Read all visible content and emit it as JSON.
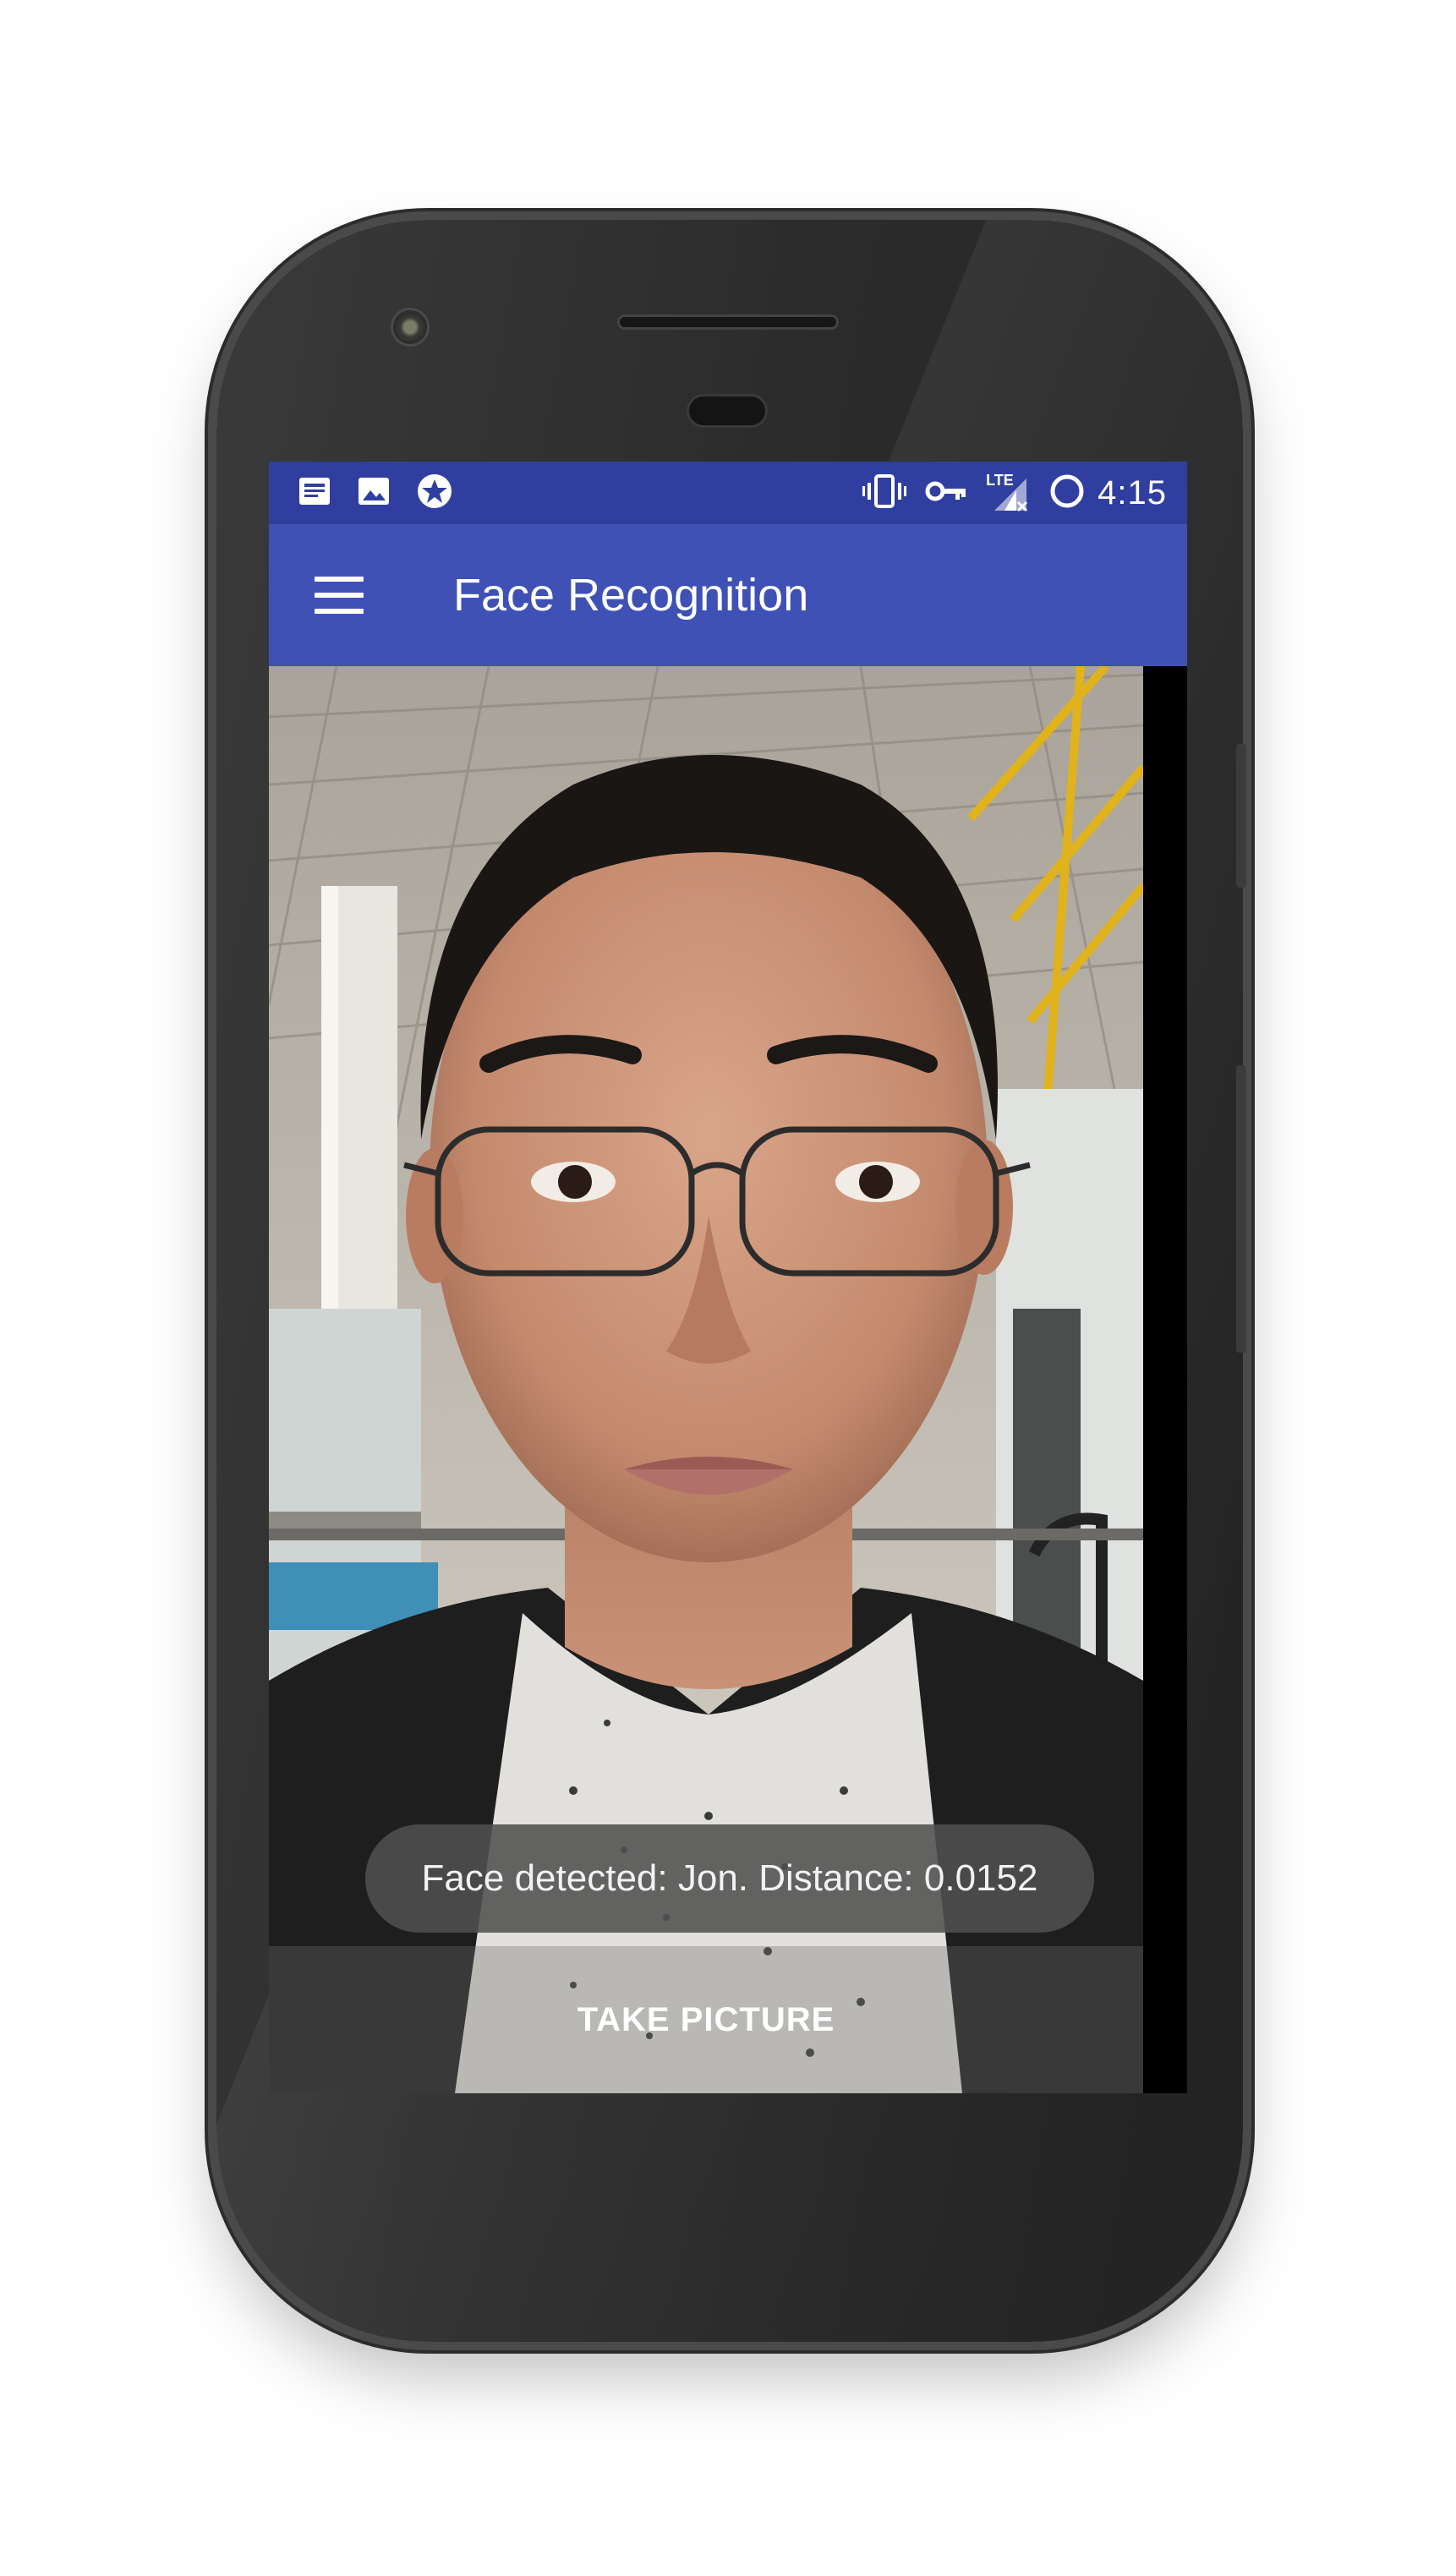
{
  "status_bar": {
    "time": "4:15",
    "left_icons": [
      "news-icon",
      "image-icon",
      "star-badge-icon"
    ],
    "right_icons": [
      "vibrate-icon",
      "vpn-key-icon",
      "lte-signal-icon",
      "sync-circle-icon"
    ],
    "network_label": "LTE"
  },
  "app_bar": {
    "title": "Face Recognition",
    "menu_icon": "hamburger-menu-icon"
  },
  "camera_view": {
    "toast": "Face detected: Jon. Distance: 0.0152"
  },
  "action": {
    "take_picture_label": "TAKE PICTURE"
  },
  "colors": {
    "status_bar": "#303f9f",
    "app_bar": "#3f51b5",
    "toast_bg": "#505050",
    "phone_body": "#2b2b2b"
  }
}
